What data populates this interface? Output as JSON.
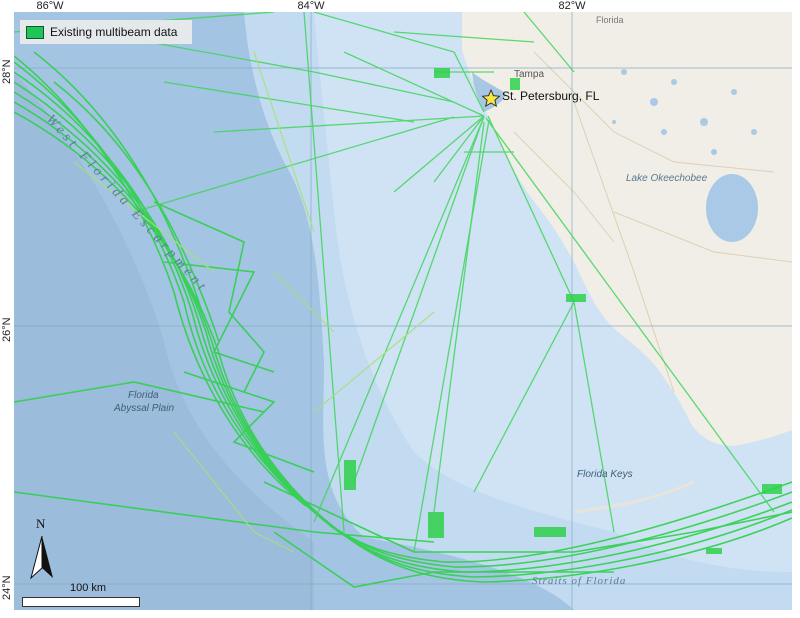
{
  "map": {
    "legend": {
      "label": "Existing multibeam data",
      "swatch_color": "#22c45a"
    },
    "longitude_ticks": [
      "86°W",
      "84°W",
      "82°W"
    ],
    "latitude_ticks": [
      "28°N",
      "26°N",
      "24°N"
    ],
    "places": {
      "st_petersburg": "St. Petersburg, FL",
      "tampa": "Tampa",
      "florida": "Florida"
    },
    "features": {
      "west_florida_escarpment": "West Florida Escarpment",
      "florida_abyssal_plain_1": "Florida",
      "florida_abyssal_plain_2": "Abyssal Plain",
      "lake_okeechobee": "Lake Okeechobee",
      "florida_keys": "Florida Keys",
      "straits_of_florida": "Straits of Florida"
    },
    "north_arrow_label": "N",
    "scale_bar_label": "100 km",
    "colors": {
      "deep_water": "#a9c9e6",
      "shelf_water": "#c9dff2",
      "land": "#f1efe8",
      "track_line": "#2ed14a",
      "track_line_light": "#9be06a"
    }
  }
}
